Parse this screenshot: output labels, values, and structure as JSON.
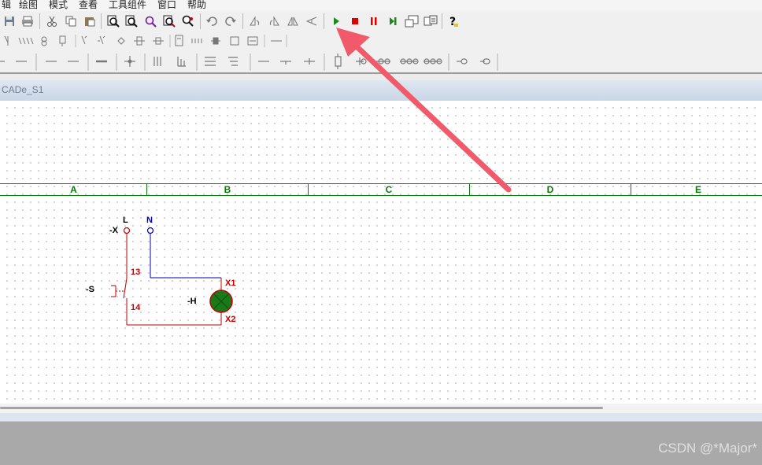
{
  "menu": [
    "辑",
    "绘图",
    "模式",
    "查看",
    "工具组件",
    "窗口",
    "帮助"
  ],
  "toolbar1": {
    "icons": [
      "save-icon",
      "print-icon",
      "cut-icon",
      "copy-icon",
      "paste-icon",
      "zoom-in-icon",
      "zoom-out-icon",
      "zoom-fit-icon",
      "zoom-area-icon",
      "zoom-pan-icon",
      "undo-icon",
      "redo-icon",
      "rotate-left-icon",
      "rotate-right-icon",
      "mirror-h-icon",
      "mirror-v-icon",
      "run-icon",
      "stop-icon",
      "pause-icon",
      "step-icon",
      "window-icon",
      "component-icon",
      "help-icon"
    ]
  },
  "tab": {
    "title": "CADe_S1"
  },
  "columns": [
    "A",
    "B",
    "C",
    "D",
    "E"
  ],
  "schematic": {
    "terminal_label": "-X",
    "phase_L": "L",
    "neutral_N": "N",
    "switch_label": "-S",
    "switch_pin_top": "13",
    "switch_pin_bottom": "14",
    "lamp_label": "-H",
    "lamp_pin_top": "X1",
    "lamp_pin_bottom": "X2"
  },
  "colors": {
    "phase_wire": "#c00000",
    "neutral_wire": "#0000b0",
    "grid_green": "#0a7a0a",
    "lamp_fill": "#1a7a1a",
    "arrow": "#f05a6a"
  },
  "watermark": "CSDN @*Major*"
}
